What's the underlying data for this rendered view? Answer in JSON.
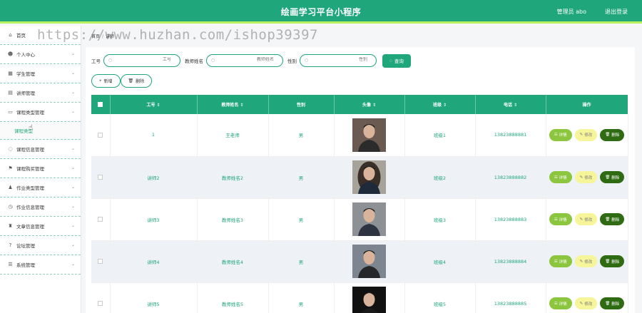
{
  "header": {
    "title": "绘画学习平台小程序",
    "user": "管理员 abo",
    "logout": "退出登录"
  },
  "watermark": "https://www.huzhan.com/ishop39397",
  "sidebar": {
    "items": [
      {
        "label": "首页",
        "icon": "home-icon",
        "glyph": "⌂",
        "has_arrow": false
      },
      {
        "label": "个人中心",
        "icon": "person-icon",
        "glyph": "☻",
        "has_arrow": true
      },
      {
        "label": "学生管理",
        "icon": "grid-icon",
        "glyph": "▦",
        "has_arrow": true
      },
      {
        "label": "讲师管理",
        "icon": "list-icon",
        "glyph": "▤",
        "has_arrow": true
      },
      {
        "label": "课程类型管理",
        "icon": "monitor-icon",
        "glyph": "▭",
        "has_arrow": true,
        "expanded": true,
        "sub": [
          "课程类型"
        ]
      },
      {
        "label": "课程信息管理",
        "icon": "circle-icon",
        "glyph": "◌",
        "has_arrow": true
      },
      {
        "label": "课程购买管理",
        "icon": "flag-icon",
        "glyph": "⚑",
        "has_arrow": true
      },
      {
        "label": "作业类型管理",
        "icon": "user-icon",
        "glyph": "♟",
        "has_arrow": true
      },
      {
        "label": "作业信息管理",
        "icon": "clock-icon",
        "glyph": "◷",
        "has_arrow": true
      },
      {
        "label": "文章信息管理",
        "icon": "trophy-icon",
        "glyph": "♜",
        "has_arrow": true
      },
      {
        "label": "论坛管理",
        "icon": "help-icon",
        "glyph": "?",
        "has_arrow": true
      },
      {
        "label": "系统管理",
        "icon": "menu-icon",
        "glyph": "☰",
        "has_arrow": true
      }
    ]
  },
  "breadcrumb": {
    "home": "首页",
    "current": "讲师"
  },
  "search": {
    "label_id": "工号",
    "placeholder_id": "工号",
    "label_name": "教师姓名",
    "placeholder_name": "教师姓名",
    "label_gender": "性别",
    "placeholder_gender": "性别",
    "button": "查询"
  },
  "actions": {
    "add": "新增",
    "delete": "删除"
  },
  "table": {
    "headers": [
      "工号",
      "教师姓名",
      "性别",
      "头像",
      "班级",
      "电话",
      "操作"
    ],
    "rows": [
      {
        "id": "1",
        "name": "王老师",
        "gender": "男",
        "class": "班级1",
        "phone": "13823888881"
      },
      {
        "id": "讲师2",
        "name": "教师姓名2",
        "gender": "男",
        "class": "班级2",
        "phone": "13823888882"
      },
      {
        "id": "讲师3",
        "name": "教师姓名3",
        "gender": "男",
        "class": "班级3",
        "phone": "13823888883"
      },
      {
        "id": "讲师4",
        "name": "教师姓名4",
        "gender": "男",
        "class": "班级4",
        "phone": "13823888884"
      },
      {
        "id": "讲师5",
        "name": "教师姓名5",
        "gender": "男",
        "class": "班级5",
        "phone": "13823888885"
      }
    ],
    "ops": {
      "detail": "详情",
      "edit": "修改",
      "delete": "删除"
    }
  },
  "colors": {
    "primary": "#1fa67a",
    "accent": "#b8f060",
    "detail": "#8cc63f",
    "edit": "#f6f59a",
    "delete": "#2f6b12"
  }
}
